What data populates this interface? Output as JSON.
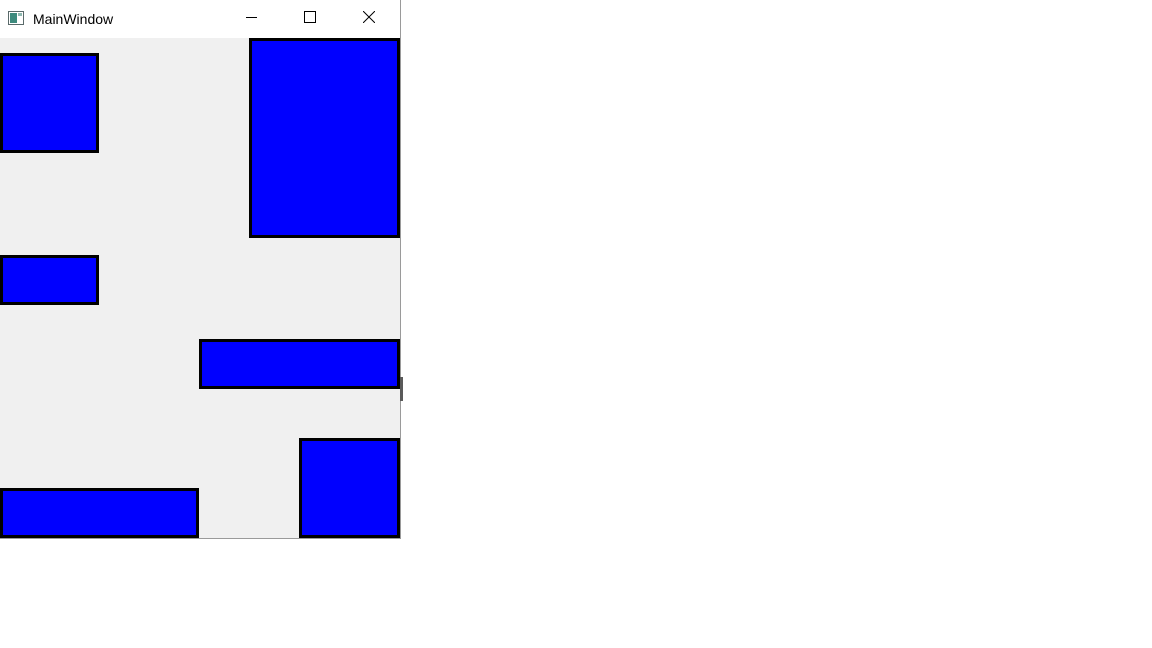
{
  "window": {
    "title": "MainWindow"
  },
  "icons": {
    "app": "app-window-icon",
    "minimize": "minimize-icon",
    "maximize": "maximize-icon",
    "close": "close-icon"
  },
  "colors": {
    "rect_fill": "#0000ff",
    "rect_border": "#000000",
    "client_bg": "#f0f0f0",
    "titlebar_bg": "#ffffff"
  }
}
